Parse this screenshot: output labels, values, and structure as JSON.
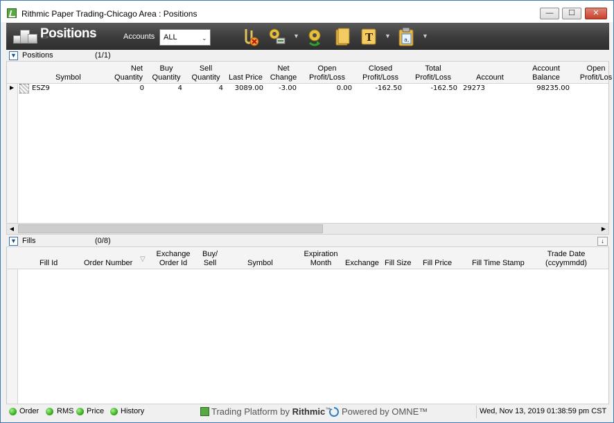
{
  "window": {
    "title": "Rithmic Paper Trading-Chicago Area : Positions",
    "min_label": "—",
    "max_label": "☐",
    "close_label": "✕"
  },
  "toolbar": {
    "title": "Positions",
    "accounts_label": "Accounts",
    "accounts_value": "ALL",
    "icons": [
      "cancel-all-icon",
      "settings-icon",
      "refresh-icon",
      "folder-icon",
      "text-icon",
      "clipboard-icon"
    ]
  },
  "positions": {
    "title": "Positions",
    "count": "(1/1)",
    "columns": [
      {
        "key": "symbol",
        "label": "Symbol"
      },
      {
        "key": "net_qty",
        "label": "Net\nQuantity"
      },
      {
        "key": "buy_qty",
        "label": "Buy\nQuantity"
      },
      {
        "key": "sell_qty",
        "label": "Sell\nQuantity"
      },
      {
        "key": "last_price",
        "label": "Last Price"
      },
      {
        "key": "net_change",
        "label": "Net\nChange"
      },
      {
        "key": "open_pl",
        "label": "Open\nProfit/Loss"
      },
      {
        "key": "closed_pl",
        "label": "Closed\nProfit/Loss"
      },
      {
        "key": "total_pl",
        "label": "Total\nProfit/Loss"
      },
      {
        "key": "account",
        "label": "Account"
      },
      {
        "key": "balance",
        "label": "Account\nBalance"
      },
      {
        "key": "open_pl2",
        "label": "Open\nProfit/Los"
      }
    ],
    "rows": [
      {
        "symbol": "ESZ9",
        "net_qty": "0",
        "buy_qty": "4",
        "sell_qty": "4",
        "last_price": "3089.00",
        "net_change": "-3.00",
        "open_pl": "0.00",
        "closed_pl": "-162.50",
        "total_pl": "-162.50",
        "account": "29273",
        "balance": "98235.00"
      }
    ]
  },
  "fills": {
    "title": "Fills",
    "count": "(0/8)",
    "columns": [
      {
        "key": "fill_id",
        "label": "Fill Id"
      },
      {
        "key": "order_number",
        "label": "Order Number"
      },
      {
        "key": "exchange_order_id",
        "label": "Exchange\nOrder Id"
      },
      {
        "key": "buy_sell",
        "label": "Buy/\nSell"
      },
      {
        "key": "symbol",
        "label": "Symbol"
      },
      {
        "key": "expiration",
        "label": "Expiration\nMonth"
      },
      {
        "key": "exchange",
        "label": "Exchange"
      },
      {
        "key": "fill_size",
        "label": "Fill Size"
      },
      {
        "key": "fill_price",
        "label": "Fill Price"
      },
      {
        "key": "fill_time",
        "label": "Fill Time Stamp"
      },
      {
        "key": "trade_date",
        "label": "Trade Date\n(ccyymmdd)"
      }
    ],
    "rows": []
  },
  "status": {
    "indicators": [
      "Order",
      "RMS",
      "Price",
      "History"
    ],
    "brand_prefix": "Trading Platform by ",
    "brand_name": "Rithmic",
    "brand_tm": "™",
    "powered": "Powered by OMNE™",
    "timestamp": "Wed, Nov 13, 2019 01:38:59 pm CST"
  },
  "colors": {
    "toolbar_bg": "#3d3d3d",
    "status_green": "#3cae23",
    "header_bg": "#f4f4f4"
  }
}
